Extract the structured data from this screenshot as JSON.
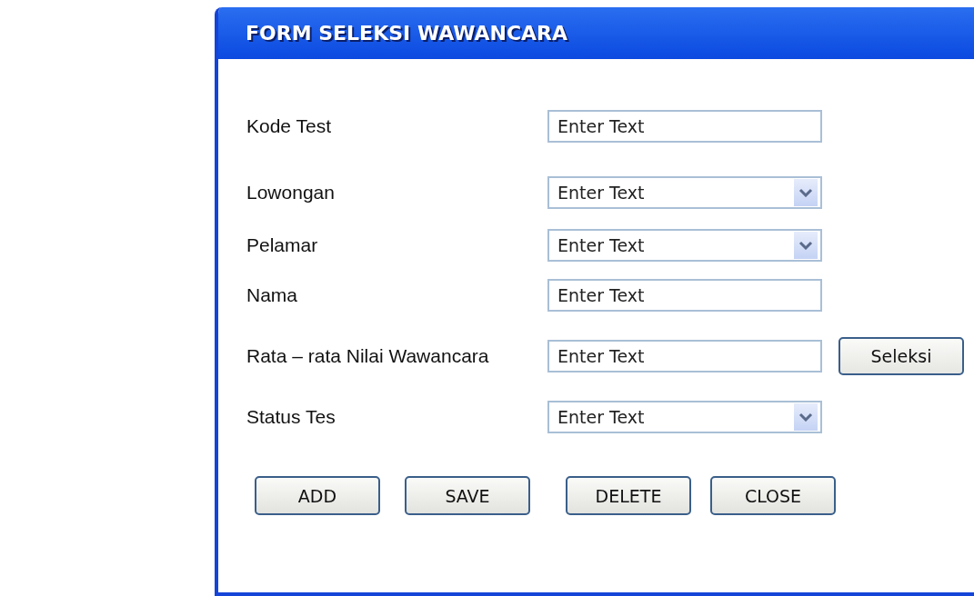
{
  "window": {
    "title": "FORM SELEKSI WAWANCARA"
  },
  "fields": [
    {
      "label": "Kode Test",
      "kind": "text",
      "placeholder": "Enter Text"
    },
    {
      "label": "Lowongan",
      "kind": "dropdown",
      "placeholder": "Enter Text"
    },
    {
      "label": "Pelamar",
      "kind": "dropdown",
      "placeholder": "Enter Text"
    },
    {
      "label": "Nama",
      "kind": "text",
      "placeholder": "Enter Text"
    },
    {
      "label": "Rata – rata Nilai Wawancara",
      "kind": "text",
      "placeholder": "Enter Text",
      "button": "Seleksi"
    },
    {
      "label": "Status Tes",
      "kind": "dropdown",
      "placeholder": "Enter Text"
    }
  ],
  "buttons": [
    "ADD",
    "SAVE",
    "DELETE",
    "CLOSE"
  ]
}
